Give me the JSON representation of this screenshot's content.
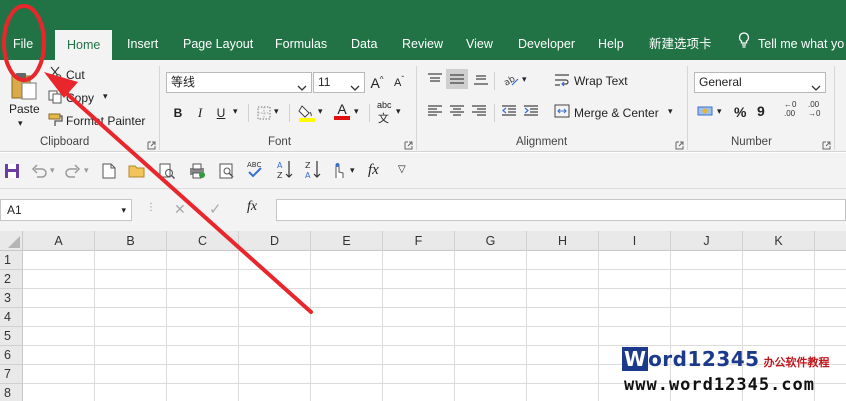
{
  "ribbon_tabs": [
    {
      "label": "File"
    },
    {
      "label": "Home"
    },
    {
      "label": "Insert"
    },
    {
      "label": "Page Layout"
    },
    {
      "label": "Formulas"
    },
    {
      "label": "Data"
    },
    {
      "label": "Review"
    },
    {
      "label": "View"
    },
    {
      "label": "Developer"
    },
    {
      "label": "Help"
    },
    {
      "label": "新建选项卡"
    },
    {
      "label": "Tell me what yo"
    }
  ],
  "clipboard": {
    "paste_label": "Paste",
    "cut_label": "Cut",
    "copy_label": "Copy",
    "format_painter_label": "Format Painter",
    "group_label": "Clipboard"
  },
  "font": {
    "font_name": "等线",
    "font_size": "11",
    "bold_label": "B",
    "italic_label": "I",
    "underline_label": "U",
    "grow_label": "A",
    "shrink_label": "A",
    "font_color_label": "A",
    "phonetic_label": "abc",
    "group_label": "Font"
  },
  "alignment": {
    "wrap_text_label": "Wrap Text",
    "merge_center_label": "Merge & Center",
    "group_label": "Alignment"
  },
  "number": {
    "format": "General",
    "percent_label": "%",
    "comma_label": "9",
    "inc_decimal_label": ".00",
    "dec_decimal_label": ".00",
    "group_label": "Number"
  },
  "quick_access": {
    "fx_label": "fx",
    "sort_a": "A",
    "sort_z": "Z",
    "spell_label": "ABC"
  },
  "formula_bar": {
    "name_box": "A1",
    "fx_label": "fx",
    "formula": ""
  },
  "grid": {
    "columns": [
      "A",
      "B",
      "C",
      "D",
      "E",
      "F",
      "G",
      "H",
      "I",
      "J",
      "K"
    ],
    "rows": [
      "1",
      "2",
      "3",
      "4",
      "5",
      "6",
      "7",
      "8"
    ]
  },
  "watermark": {
    "logo_letter": "W",
    "logo_text": "ord12345",
    "tagline": "办公软件教程",
    "url": "www.word12345.com"
  },
  "colors": {
    "excel_green": "#217346",
    "annotation_red": "#e8262b",
    "watermark_blue": "#1c3a8c"
  },
  "icons": [
    "paste-icon",
    "cut-icon",
    "copy-icon",
    "format-painter-icon",
    "fill-color-icon",
    "font-color-icon",
    "borders-icon",
    "wrap-text-icon",
    "merge-icon",
    "save-icon",
    "undo-icon",
    "redo-icon",
    "new-icon",
    "open-icon",
    "print-icon",
    "sort-ascending-icon",
    "sort-descending-icon",
    "lightbulb-icon"
  ]
}
